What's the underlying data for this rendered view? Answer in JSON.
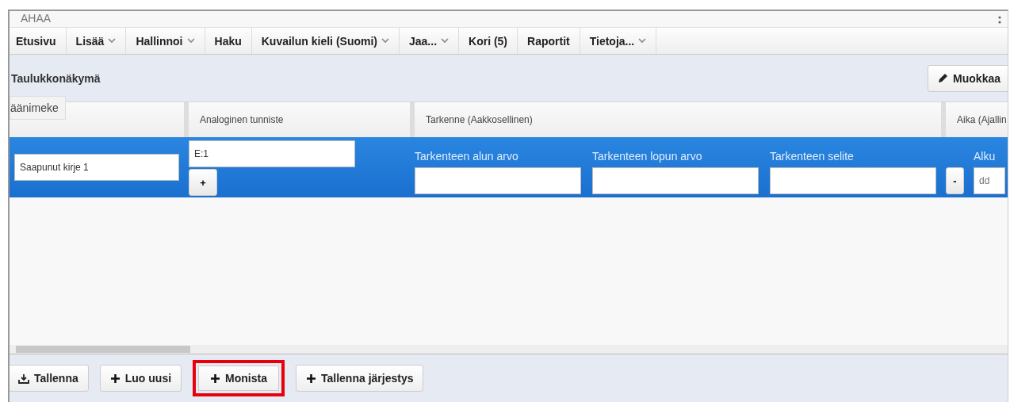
{
  "app_title": "AHAA",
  "nav": [
    {
      "label": "Etusivu",
      "dropdown": false
    },
    {
      "label": "Lisää",
      "dropdown": true
    },
    {
      "label": "Hallinnoi",
      "dropdown": true
    },
    {
      "label": "Haku",
      "dropdown": false
    },
    {
      "label": "Kuvailun kieli (Suomi)",
      "dropdown": true
    },
    {
      "label": "Jaa...",
      "dropdown": true
    },
    {
      "label": "Kori (5)",
      "dropdown": false
    },
    {
      "label": "Raportit",
      "dropdown": false
    },
    {
      "label": "Tietoja...",
      "dropdown": true
    }
  ],
  "toolbar": {
    "title": "Taulukkonäkymä",
    "edit_button": "Muokkaa"
  },
  "table": {
    "columns": [
      "äänimeke",
      "Analoginen tunniste",
      "Tarkenne (Aakkosellinen)",
      "Aika (Ajallin"
    ],
    "rows": [
      {
        "selected": true,
        "title": "Saapunut kirje 1",
        "identifier": "E:1",
        "add_button": "+",
        "refinement_fields": [
          {
            "label": "Tarkenteen alun arvo"
          },
          {
            "label": "Tarkenteen lopun arvo"
          },
          {
            "label": "Tarkenteen selite"
          }
        ],
        "remove_button": "-",
        "time_label": "Alku",
        "time_placeholder": "dd"
      }
    ]
  },
  "footer": {
    "buttons": [
      {
        "label": "Tallenna",
        "kind": "save",
        "highlighted": false
      },
      {
        "label": "Luo uusi",
        "kind": "add",
        "highlighted": false
      },
      {
        "label": "Monista",
        "kind": "add",
        "highlighted": true
      },
      {
        "label": "Tallenna järjestys",
        "kind": "add",
        "highlighted": false
      }
    ]
  }
}
